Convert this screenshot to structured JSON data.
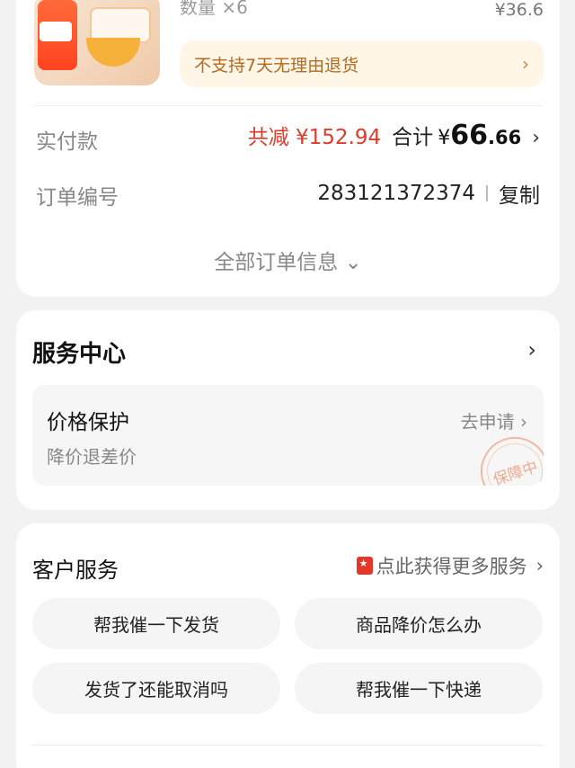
{
  "product": {
    "quantity": "数量 ×6",
    "unit_price": "¥36.6",
    "return_policy": "不支持7天无理由退货"
  },
  "payment": {
    "label": "实付款",
    "discount": "共减 ¥152.94",
    "total_label": "合计",
    "currency": "¥",
    "total_int": "66",
    "total_dec": ".66"
  },
  "order": {
    "label": "订单编号",
    "number": "283121372374",
    "copy_label": "复制"
  },
  "all_info_label": "全部订单信息",
  "service_center": {
    "title": "服务中心",
    "price_protect": {
      "title": "价格保护",
      "subtitle": "降价退差价",
      "action": "去申请",
      "stamp": "保障中"
    }
  },
  "customer_service": {
    "title": "客户服务",
    "more_link": "点此获得更多服务",
    "quick_questions": [
      "帮我催一下发货",
      "商品降价怎么办",
      "发货了还能取消吗",
      "帮我催一下快递"
    ]
  },
  "icons": {
    "chevron_right": "›",
    "chevron_down": "⌄"
  },
  "colors": {
    "discount_red": "#e23a2a",
    "notice_bg": "#fff6e8",
    "notice_text": "#b46a1d"
  }
}
